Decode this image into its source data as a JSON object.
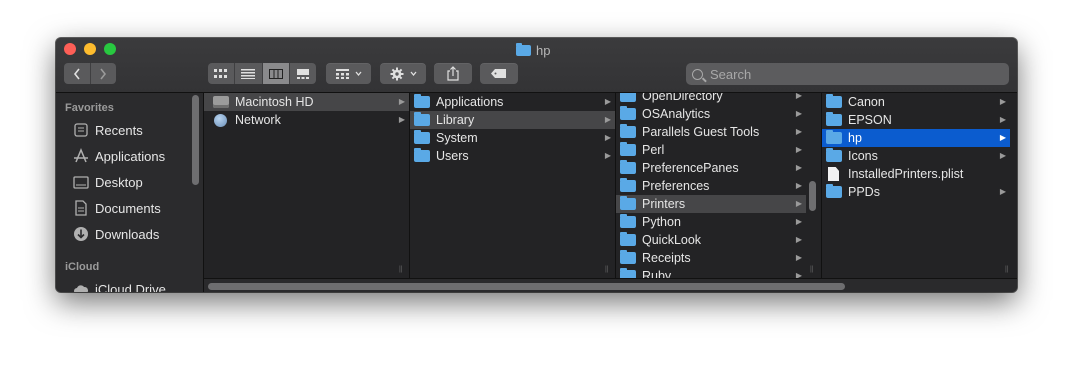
{
  "window": {
    "title": "hp"
  },
  "toolbar": {
    "search_placeholder": "Search"
  },
  "sidebar": {
    "favorites_header": "Favorites",
    "favorites": [
      {
        "label": "Recents",
        "icon": "clock-icon"
      },
      {
        "label": "Applications",
        "icon": "applications-icon"
      },
      {
        "label": "Desktop",
        "icon": "desktop-icon"
      },
      {
        "label": "Documents",
        "icon": "documents-icon"
      },
      {
        "label": "Downloads",
        "icon": "downloads-icon"
      }
    ],
    "icloud_header": "iCloud",
    "icloud": [
      {
        "label": "iCloud Drive",
        "icon": "cloud-icon"
      }
    ]
  },
  "columns": [
    {
      "items": [
        {
          "label": "Macintosh HD",
          "icon": "disk",
          "arrow": true,
          "selected": "grey"
        },
        {
          "label": "Network",
          "icon": "globe",
          "arrow": true
        }
      ]
    },
    {
      "items": [
        {
          "label": "Applications",
          "icon": "folder",
          "arrow": true
        },
        {
          "label": "Library",
          "icon": "folder",
          "arrow": true,
          "selected": "grey"
        },
        {
          "label": "System",
          "icon": "folder",
          "arrow": true
        },
        {
          "label": "Users",
          "icon": "folder",
          "arrow": true
        }
      ]
    },
    {
      "items": [
        {
          "label": "OpenDirectory",
          "icon": "folder",
          "arrow": true
        },
        {
          "label": "OSAnalytics",
          "icon": "folder",
          "arrow": true
        },
        {
          "label": "Parallels Guest Tools",
          "icon": "folder",
          "arrow": true
        },
        {
          "label": "Perl",
          "icon": "folder",
          "arrow": true
        },
        {
          "label": "PreferencePanes",
          "icon": "folder",
          "arrow": true
        },
        {
          "label": "Preferences",
          "icon": "folder",
          "arrow": true
        },
        {
          "label": "Printers",
          "icon": "folder",
          "arrow": true,
          "selected": "grey"
        },
        {
          "label": "Python",
          "icon": "folder",
          "arrow": true
        },
        {
          "label": "QuickLook",
          "icon": "folder",
          "arrow": true
        },
        {
          "label": "Receipts",
          "icon": "folder",
          "arrow": true
        },
        {
          "label": "Ruby",
          "icon": "folder",
          "arrow": true
        }
      ]
    },
    {
      "items": [
        {
          "label": "Canon",
          "icon": "folder",
          "arrow": true
        },
        {
          "label": "EPSON",
          "icon": "folder",
          "arrow": true
        },
        {
          "label": "hp",
          "icon": "folder",
          "arrow": true,
          "selected": "blue"
        },
        {
          "label": "Icons",
          "icon": "folder",
          "arrow": true
        },
        {
          "label": "InstalledPrinters.plist",
          "icon": "document",
          "arrow": false
        },
        {
          "label": "PPDs",
          "icon": "folder",
          "arrow": true
        }
      ]
    }
  ],
  "colors": {
    "selection_blue": "#0b5ccf",
    "folder_blue": "#5aa9e6"
  }
}
